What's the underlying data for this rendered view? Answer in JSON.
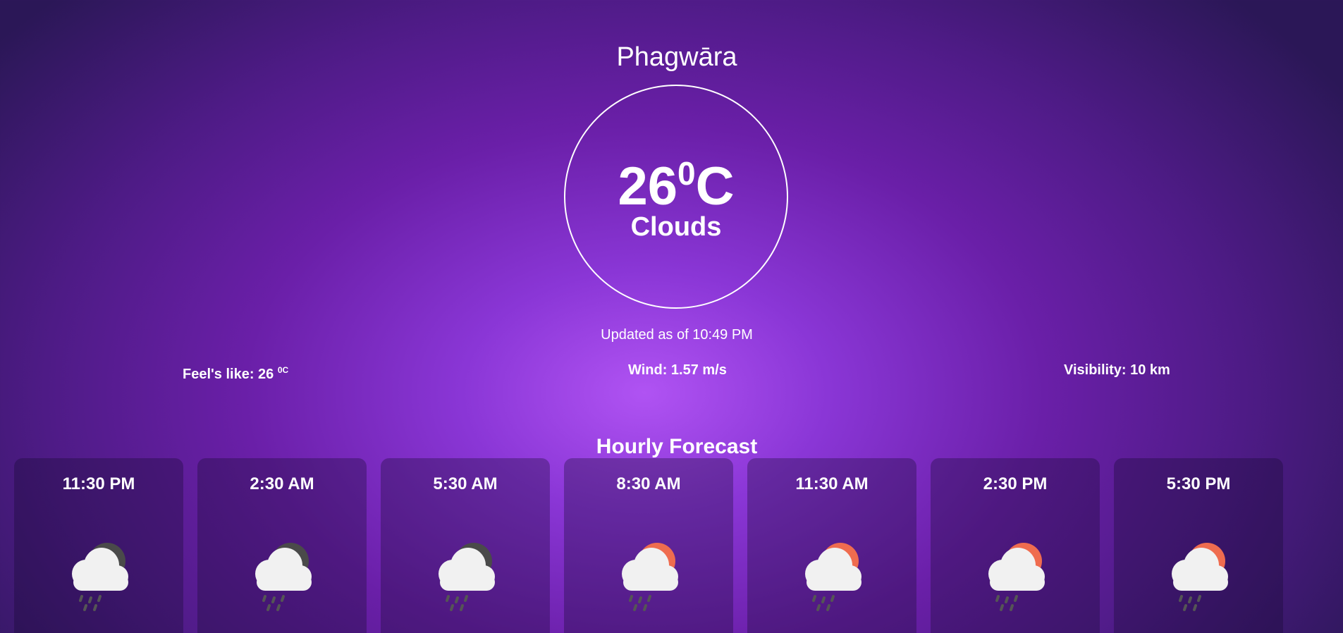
{
  "location": {
    "city": "Phagwāra"
  },
  "current": {
    "temperature": "26",
    "degree_mark": "0",
    "unit": "C",
    "condition": "Clouds",
    "updated": "Updated as of 10:49 PM"
  },
  "details": {
    "feels_like_label": "Feel's like: 26",
    "feels_like_unit": "0C",
    "wind": "Wind: 1.57 m/s",
    "visibility": "Visibility: 10 km"
  },
  "forecast": {
    "title": "Hourly Forecast",
    "hours": [
      {
        "time": "11:30 PM",
        "icon": "cloud-moon-rain-icon"
      },
      {
        "time": "2:30 AM",
        "icon": "cloud-moon-rain-icon"
      },
      {
        "time": "5:30 AM",
        "icon": "cloud-moon-rain-icon"
      },
      {
        "time": "8:30 AM",
        "icon": "cloud-sun-rain-icon"
      },
      {
        "time": "11:30 AM",
        "icon": "cloud-sun-rain-icon"
      },
      {
        "time": "2:30 PM",
        "icon": "cloud-sun-rain-icon"
      },
      {
        "time": "5:30 PM",
        "icon": "cloud-sun-rain-icon"
      }
    ]
  },
  "colors": {
    "background_center": "#b053f3",
    "background_edge": "#2b1757",
    "sun": "#ef6c4f",
    "moon": "#4a4a4a",
    "cloud": "#f1f1f1",
    "rain": "#555555"
  }
}
